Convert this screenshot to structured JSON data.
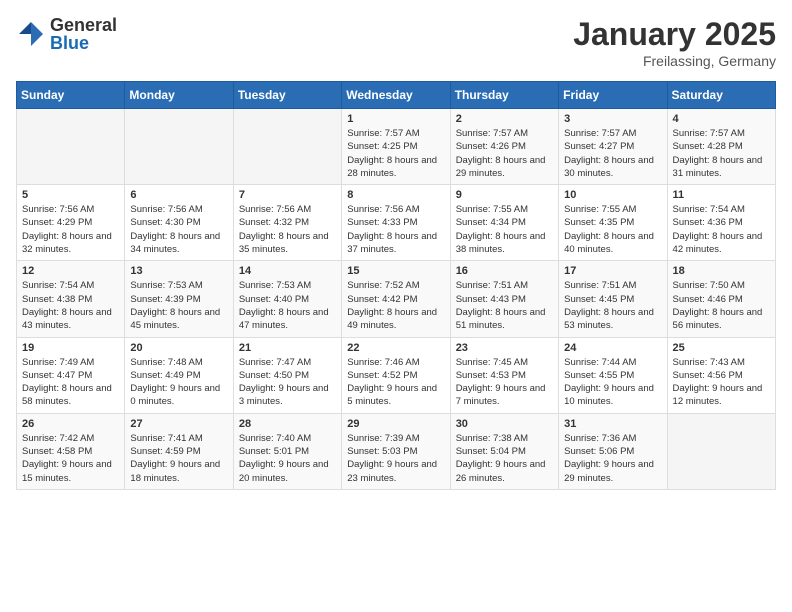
{
  "header": {
    "logo_general": "General",
    "logo_blue": "Blue",
    "month_title": "January 2025",
    "location": "Freilassing, Germany"
  },
  "days_of_week": [
    "Sunday",
    "Monday",
    "Tuesday",
    "Wednesday",
    "Thursday",
    "Friday",
    "Saturday"
  ],
  "weeks": [
    [
      {
        "day": "",
        "sunrise": "",
        "sunset": "",
        "daylight": ""
      },
      {
        "day": "",
        "sunrise": "",
        "sunset": "",
        "daylight": ""
      },
      {
        "day": "",
        "sunrise": "",
        "sunset": "",
        "daylight": ""
      },
      {
        "day": "1",
        "sunrise": "Sunrise: 7:57 AM",
        "sunset": "Sunset: 4:25 PM",
        "daylight": "Daylight: 8 hours and 28 minutes."
      },
      {
        "day": "2",
        "sunrise": "Sunrise: 7:57 AM",
        "sunset": "Sunset: 4:26 PM",
        "daylight": "Daylight: 8 hours and 29 minutes."
      },
      {
        "day": "3",
        "sunrise": "Sunrise: 7:57 AM",
        "sunset": "Sunset: 4:27 PM",
        "daylight": "Daylight: 8 hours and 30 minutes."
      },
      {
        "day": "4",
        "sunrise": "Sunrise: 7:57 AM",
        "sunset": "Sunset: 4:28 PM",
        "daylight": "Daylight: 8 hours and 31 minutes."
      }
    ],
    [
      {
        "day": "5",
        "sunrise": "Sunrise: 7:56 AM",
        "sunset": "Sunset: 4:29 PM",
        "daylight": "Daylight: 8 hours and 32 minutes."
      },
      {
        "day": "6",
        "sunrise": "Sunrise: 7:56 AM",
        "sunset": "Sunset: 4:30 PM",
        "daylight": "Daylight: 8 hours and 34 minutes."
      },
      {
        "day": "7",
        "sunrise": "Sunrise: 7:56 AM",
        "sunset": "Sunset: 4:32 PM",
        "daylight": "Daylight: 8 hours and 35 minutes."
      },
      {
        "day": "8",
        "sunrise": "Sunrise: 7:56 AM",
        "sunset": "Sunset: 4:33 PM",
        "daylight": "Daylight: 8 hours and 37 minutes."
      },
      {
        "day": "9",
        "sunrise": "Sunrise: 7:55 AM",
        "sunset": "Sunset: 4:34 PM",
        "daylight": "Daylight: 8 hours and 38 minutes."
      },
      {
        "day": "10",
        "sunrise": "Sunrise: 7:55 AM",
        "sunset": "Sunset: 4:35 PM",
        "daylight": "Daylight: 8 hours and 40 minutes."
      },
      {
        "day": "11",
        "sunrise": "Sunrise: 7:54 AM",
        "sunset": "Sunset: 4:36 PM",
        "daylight": "Daylight: 8 hours and 42 minutes."
      }
    ],
    [
      {
        "day": "12",
        "sunrise": "Sunrise: 7:54 AM",
        "sunset": "Sunset: 4:38 PM",
        "daylight": "Daylight: 8 hours and 43 minutes."
      },
      {
        "day": "13",
        "sunrise": "Sunrise: 7:53 AM",
        "sunset": "Sunset: 4:39 PM",
        "daylight": "Daylight: 8 hours and 45 minutes."
      },
      {
        "day": "14",
        "sunrise": "Sunrise: 7:53 AM",
        "sunset": "Sunset: 4:40 PM",
        "daylight": "Daylight: 8 hours and 47 minutes."
      },
      {
        "day": "15",
        "sunrise": "Sunrise: 7:52 AM",
        "sunset": "Sunset: 4:42 PM",
        "daylight": "Daylight: 8 hours and 49 minutes."
      },
      {
        "day": "16",
        "sunrise": "Sunrise: 7:51 AM",
        "sunset": "Sunset: 4:43 PM",
        "daylight": "Daylight: 8 hours and 51 minutes."
      },
      {
        "day": "17",
        "sunrise": "Sunrise: 7:51 AM",
        "sunset": "Sunset: 4:45 PM",
        "daylight": "Daylight: 8 hours and 53 minutes."
      },
      {
        "day": "18",
        "sunrise": "Sunrise: 7:50 AM",
        "sunset": "Sunset: 4:46 PM",
        "daylight": "Daylight: 8 hours and 56 minutes."
      }
    ],
    [
      {
        "day": "19",
        "sunrise": "Sunrise: 7:49 AM",
        "sunset": "Sunset: 4:47 PM",
        "daylight": "Daylight: 8 hours and 58 minutes."
      },
      {
        "day": "20",
        "sunrise": "Sunrise: 7:48 AM",
        "sunset": "Sunset: 4:49 PM",
        "daylight": "Daylight: 9 hours and 0 minutes."
      },
      {
        "day": "21",
        "sunrise": "Sunrise: 7:47 AM",
        "sunset": "Sunset: 4:50 PM",
        "daylight": "Daylight: 9 hours and 3 minutes."
      },
      {
        "day": "22",
        "sunrise": "Sunrise: 7:46 AM",
        "sunset": "Sunset: 4:52 PM",
        "daylight": "Daylight: 9 hours and 5 minutes."
      },
      {
        "day": "23",
        "sunrise": "Sunrise: 7:45 AM",
        "sunset": "Sunset: 4:53 PM",
        "daylight": "Daylight: 9 hours and 7 minutes."
      },
      {
        "day": "24",
        "sunrise": "Sunrise: 7:44 AM",
        "sunset": "Sunset: 4:55 PM",
        "daylight": "Daylight: 9 hours and 10 minutes."
      },
      {
        "day": "25",
        "sunrise": "Sunrise: 7:43 AM",
        "sunset": "Sunset: 4:56 PM",
        "daylight": "Daylight: 9 hours and 12 minutes."
      }
    ],
    [
      {
        "day": "26",
        "sunrise": "Sunrise: 7:42 AM",
        "sunset": "Sunset: 4:58 PM",
        "daylight": "Daylight: 9 hours and 15 minutes."
      },
      {
        "day": "27",
        "sunrise": "Sunrise: 7:41 AM",
        "sunset": "Sunset: 4:59 PM",
        "daylight": "Daylight: 9 hours and 18 minutes."
      },
      {
        "day": "28",
        "sunrise": "Sunrise: 7:40 AM",
        "sunset": "Sunset: 5:01 PM",
        "daylight": "Daylight: 9 hours and 20 minutes."
      },
      {
        "day": "29",
        "sunrise": "Sunrise: 7:39 AM",
        "sunset": "Sunset: 5:03 PM",
        "daylight": "Daylight: 9 hours and 23 minutes."
      },
      {
        "day": "30",
        "sunrise": "Sunrise: 7:38 AM",
        "sunset": "Sunset: 5:04 PM",
        "daylight": "Daylight: 9 hours and 26 minutes."
      },
      {
        "day": "31",
        "sunrise": "Sunrise: 7:36 AM",
        "sunset": "Sunset: 5:06 PM",
        "daylight": "Daylight: 9 hours and 29 minutes."
      },
      {
        "day": "",
        "sunrise": "",
        "sunset": "",
        "daylight": ""
      }
    ]
  ]
}
